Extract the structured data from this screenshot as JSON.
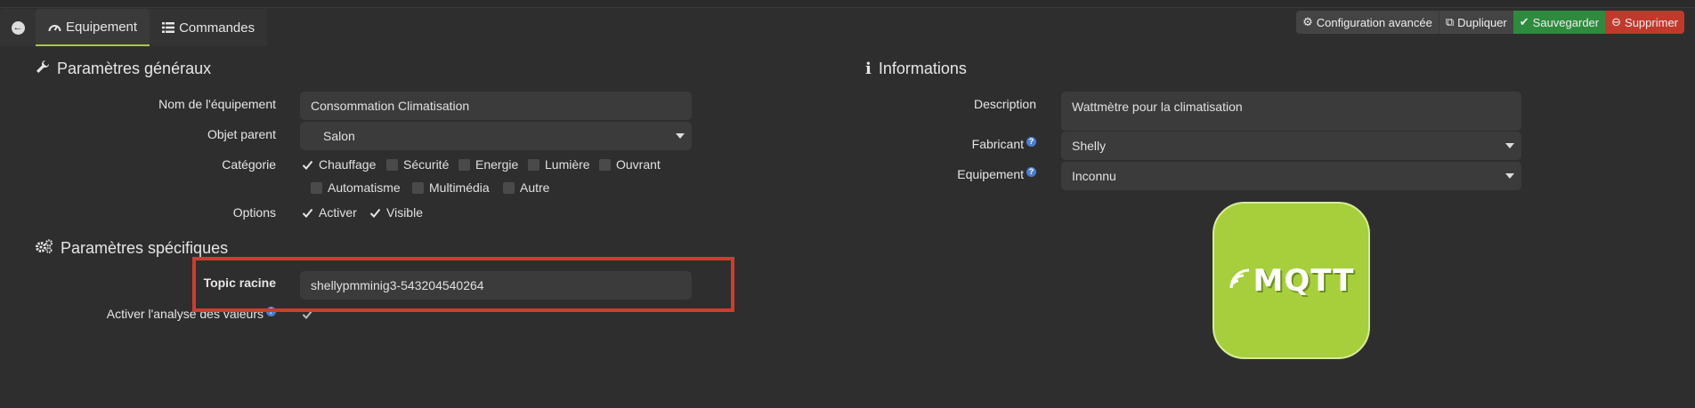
{
  "tabs": [
    {
      "label": "Equipement",
      "icon": "gauge-icon"
    },
    {
      "label": "Commandes",
      "icon": "list-icon"
    }
  ],
  "actions": {
    "config_label": "Configuration avancée",
    "duplicate_label": "Dupliquer",
    "save_label": "Sauvegarder",
    "delete_label": "Supprimer"
  },
  "general": {
    "title": "Paramètres généraux",
    "name_label": "Nom de l'équipement",
    "name_value": "Consommation Climatisation",
    "parent_label": "Objet parent",
    "parent_value": "Salon",
    "category_label": "Catégorie",
    "categories": [
      {
        "label": "Chauffage",
        "checked": true
      },
      {
        "label": "Sécurité",
        "checked": false
      },
      {
        "label": "Energie",
        "checked": false
      },
      {
        "label": "Lumière",
        "checked": false
      },
      {
        "label": "Ouvrant",
        "checked": false
      },
      {
        "label": "Automatisme",
        "checked": false
      },
      {
        "label": "Multimédia",
        "checked": false
      },
      {
        "label": "Autre",
        "checked": false
      }
    ],
    "options_label": "Options",
    "options": [
      {
        "label": "Activer",
        "checked": true
      },
      {
        "label": "Visible",
        "checked": true
      }
    ]
  },
  "specific": {
    "title": "Paramètres spécifiques",
    "topic_label": "Topic racine",
    "topic_value": "shellypmminig3-543204540264",
    "analysis_label": "Activer l'analyse des valeurs",
    "analysis_checked": true
  },
  "info": {
    "title": "Informations",
    "description_label": "Description",
    "description_value": "Wattmètre pour la climatisation",
    "manufacturer_label": "Fabricant",
    "manufacturer_value": "Shelly",
    "equipment_label": "Equipement",
    "equipment_value": "Inconnu"
  },
  "logo": {
    "text": "MQTT",
    "color": "#a6cf3b"
  },
  "colors": {
    "accent": "#a9c74a",
    "save": "#2e8b3e",
    "delete": "#c0392b",
    "highlight": "#d33a2c"
  }
}
